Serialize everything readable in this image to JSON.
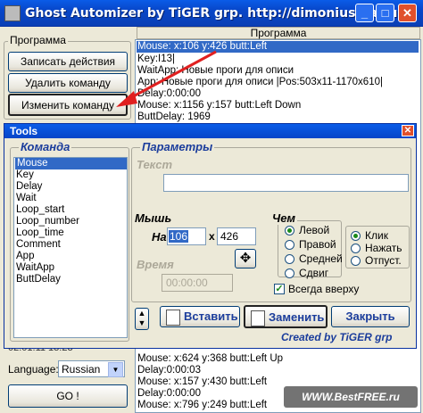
{
  "window": {
    "title": "Ghost Automizer by TiGER grp. http://dimonius.da.ru"
  },
  "left_panel": {
    "group_title": "Программа",
    "buttons": [
      "Записать действия",
      "Удалить команду",
      "Изменить команду"
    ],
    "datetime": "02.01.11 13:23",
    "language_label": "Language:",
    "language_value": "Russian",
    "go_button": "GO !"
  },
  "program_list": {
    "header": "Программа",
    "top_rows": [
      "Mouse: x:106 y:426 butt:Left",
      "Key:I13|",
      "WaitApp: Новые проги для описи",
      "App: Новые проги для описи |Pos:503x11-1170x610|",
      "Delay:0:00:00",
      "Mouse: x:1156 y:157 butt:Left Down",
      "ButtDelay: 1969"
    ],
    "bottom_rows": [
      "Mouse: x:624 y:368 butt:Left Up",
      "Delay:0:00:03",
      "Mouse: x:157 y:430 butt:Left",
      "Delay:0:00:00",
      "Mouse: x:796 y:249 butt:Left"
    ]
  },
  "tools": {
    "title": "Tools",
    "command_legend": "Команда",
    "commands": [
      "Mouse",
      "Key",
      "Delay",
      "Wait",
      "Loop_start",
      "Loop_number",
      "Loop_time",
      "Comment",
      "App",
      "WaitApp",
      "ButtDelay"
    ],
    "selected_command": "Mouse",
    "params_legend": "Параметры",
    "text_label": "Текст",
    "mouse_label": "Мышь",
    "on_label": "На",
    "x_value": "106",
    "x_sep": "x",
    "y_value": "426",
    "which_label": "Чем",
    "which_options": [
      "Левой",
      "Правой",
      "Средней",
      "Сдвиг"
    ],
    "action_options": [
      "Клик",
      "Нажать",
      "Отпуст."
    ],
    "time_label": "Время",
    "time_value": "00:00:00",
    "always_on_top": "Всегда вверху",
    "insert_button": "Вставить",
    "replace_button": "Заменить",
    "close_button": "Закрыть",
    "created_by": "Created by TiGER grp"
  },
  "watermark": "WWW.BestFREE.ru",
  "colors": {
    "accent": "#1b3d9c",
    "selection": "#3169c6",
    "arrow": "#e02020"
  }
}
